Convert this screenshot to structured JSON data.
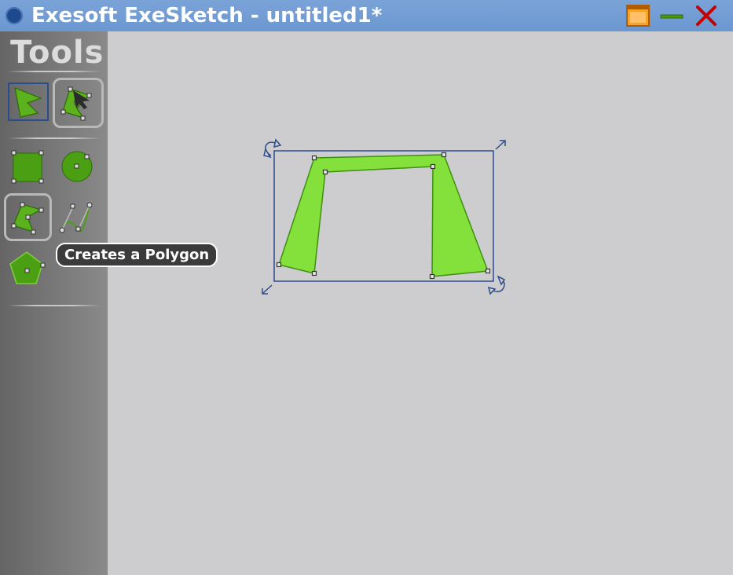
{
  "window": {
    "title": "Exesoft ExeSketch - untitled1*",
    "icons": {
      "app": "app-logo-icon",
      "maximize": "maximize-icon",
      "minimize": "minimize-icon",
      "close": "close-icon"
    },
    "colors": {
      "titlebar": "#7aa3d8",
      "close": "#c00000",
      "minimize": "#4a9a10",
      "maximize": "#f5a623"
    }
  },
  "toolbox": {
    "heading": "Tools",
    "tools": [
      {
        "id": "select-tool",
        "icon": "selection-arrow-icon",
        "selected": true
      },
      {
        "id": "edit-points-tool",
        "icon": "edit-points-icon",
        "pressed": true
      },
      {
        "id": "rectangle-tool",
        "icon": "rectangle-icon"
      },
      {
        "id": "circle-tool",
        "icon": "circle-icon"
      },
      {
        "id": "polygon-tool",
        "icon": "polygon-icon",
        "pressed": true
      },
      {
        "id": "curve-tool",
        "icon": "bezier-curve-icon"
      },
      {
        "id": "regular-polygon-tool",
        "icon": "pentagon-icon"
      }
    ]
  },
  "tooltip": {
    "text": "Creates a Polygon"
  },
  "canvas": {
    "background": "#cdcdcf",
    "shape": {
      "type": "polygon",
      "fill": "#84e03a",
      "stroke": "#3f9010",
      "selected": true
    },
    "selection_color": "#2b4d8c"
  }
}
